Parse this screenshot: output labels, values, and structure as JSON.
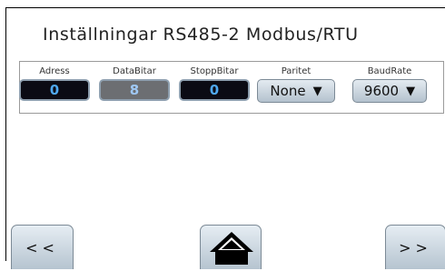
{
  "header": {
    "title": "Inställningar RS485-2 Modbus/RTU"
  },
  "settings": {
    "adress": {
      "label": "Adress",
      "value": "0"
    },
    "databitar": {
      "label": "DataBitar",
      "value": "8"
    },
    "stoppbitar": {
      "label": "StoppBitar",
      "value": "0"
    },
    "paritet": {
      "label": "Paritet",
      "value": "None"
    },
    "baudrate": {
      "label": "BaudRate",
      "value": "9600"
    }
  },
  "nav": {
    "prev_label": "<<",
    "next_label": ">>",
    "home_icon": "home-icon"
  },
  "colors": {
    "field_dark": "#0b0b14",
    "field_disabled": "#6c6e72",
    "value_text": "#4fa8f0"
  }
}
